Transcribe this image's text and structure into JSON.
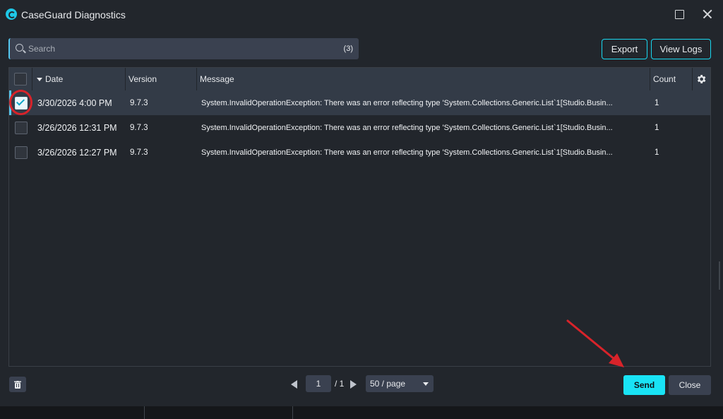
{
  "window": {
    "title": "CaseGuard Diagnostics"
  },
  "search": {
    "placeholder": "Search",
    "count": "(3)"
  },
  "toolbar": {
    "export_label": "Export",
    "view_logs_label": "View Logs"
  },
  "grid": {
    "columns": {
      "date": "Date",
      "version": "Version",
      "message": "Message",
      "count": "Count"
    },
    "rows": [
      {
        "checked": true,
        "date": "3/30/2026 4:00 PM",
        "version": "9.7.3",
        "message": "System.InvalidOperationException: There was an error reflecting type 'System.Collections.Generic.List`1[Studio.Busin...",
        "count": "1"
      },
      {
        "checked": false,
        "date": "3/26/2026 12:31 PM",
        "version": "9.7.3",
        "message": "System.InvalidOperationException: There was an error reflecting type 'System.Collections.Generic.List`1[Studio.Busin...",
        "count": "1"
      },
      {
        "checked": false,
        "date": "3/26/2026 12:27 PM",
        "version": "9.7.3",
        "message": "System.InvalidOperationException: There was an error reflecting type 'System.Collections.Generic.List`1[Studio.Busin...",
        "count": "1"
      }
    ]
  },
  "pager": {
    "current_page": "1",
    "total": "/ 1",
    "page_size": "50 / page"
  },
  "footer": {
    "send_label": "Send",
    "close_label": "Close"
  },
  "colors": {
    "accent": "#19e3f5",
    "background": "#22262c",
    "header": "#333b47",
    "annotation": "#d8232a"
  },
  "icons": [
    "app-logo-icon",
    "maximize-icon",
    "close-icon",
    "search-icon",
    "sort-desc-icon",
    "gear-icon",
    "check-icon",
    "trash-icon",
    "prev-page-icon",
    "next-page-icon",
    "chevron-down-icon"
  ]
}
